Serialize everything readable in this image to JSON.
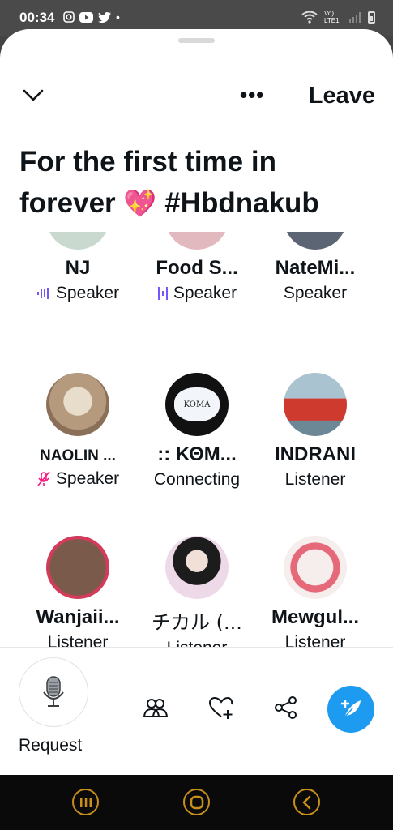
{
  "status": {
    "time": "00:34",
    "network": "Vo) LTE1"
  },
  "header": {
    "more_label": "•••",
    "leave_label": "Leave"
  },
  "space": {
    "title_part1": "For the first time in forever ",
    "heart": "💖",
    "title_part2": " #Hbdnakub"
  },
  "participants": [
    {
      "name": "NJ",
      "role": "Speaker",
      "icon": "speaking-icon",
      "color": "#c9d9cf"
    },
    {
      "name": "Food S...",
      "role": "Speaker",
      "icon": "speaking-icon",
      "color": "#e3b9c0"
    },
    {
      "name": "NateMi...",
      "role": "Speaker",
      "icon": "",
      "color": "#5b6573"
    },
    {
      "name": "NAOLIN ...",
      "role": "Speaker",
      "icon": "muted-mic-icon",
      "color": "#b8a58c"
    },
    {
      "name": ":: ΚΘΜ...",
      "role": "Connecting",
      "icon": "",
      "color": "#111111"
    },
    {
      "name": "INDRANI",
      "role": "Listener",
      "icon": "",
      "color": "#8fb0c4"
    },
    {
      "name": "Wanjaii...",
      "role": "Listener",
      "icon": "",
      "color": "#7a5a4a"
    },
    {
      "name": "チカル (...",
      "role": "Listener",
      "icon": "",
      "color": "#eed9e8"
    },
    {
      "name": "Mewgul...",
      "role": "Listener",
      "icon": "",
      "color": "#f6eded"
    }
  ],
  "bottom": {
    "request_label": "Request"
  },
  "colors": {
    "accent": "#1d9bf0",
    "speaking": "#7856ff",
    "muted": "#f91880"
  }
}
